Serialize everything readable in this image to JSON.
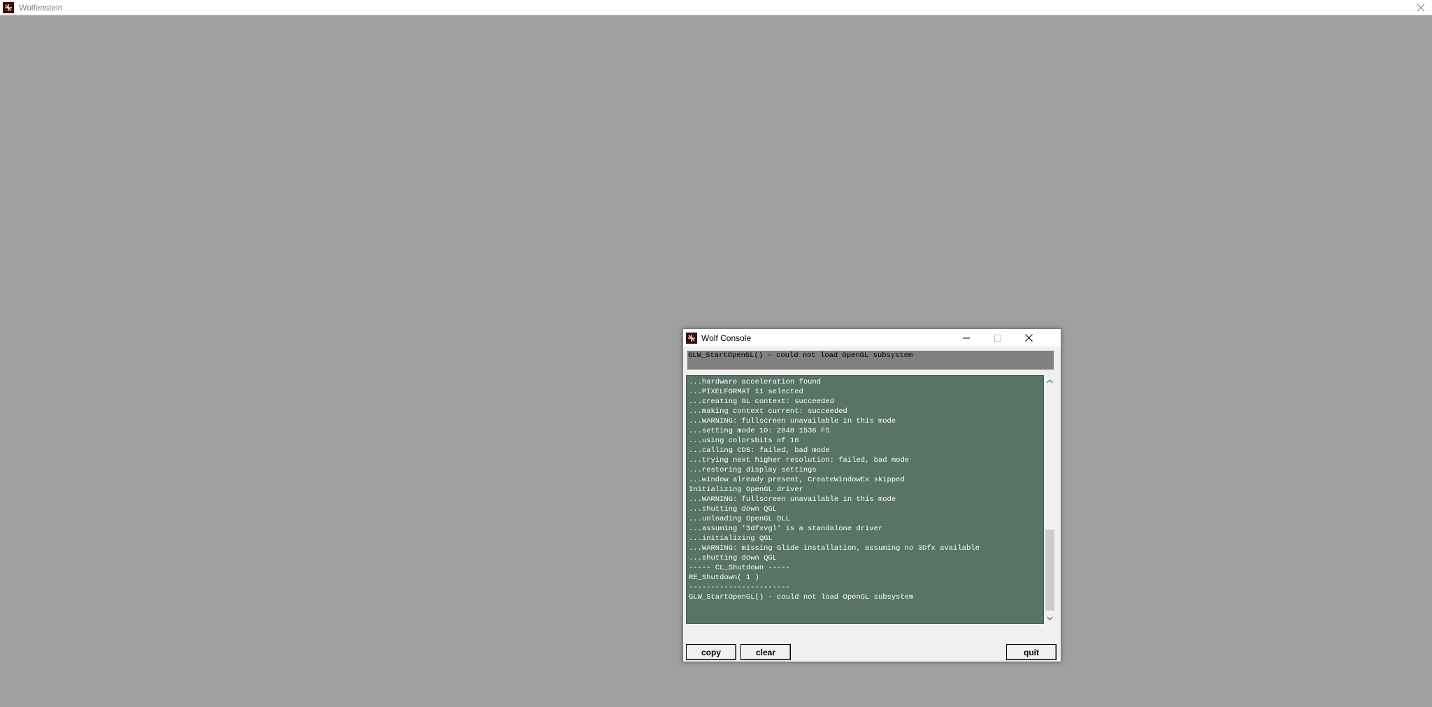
{
  "main_window": {
    "title": "Wolfenstein"
  },
  "console": {
    "title": "Wolf Console",
    "error_line": "GLW_StartOpenGL() - could not load OpenGL subsystem",
    "log_lines": [
      "...hardware acceleration found",
      "...PIXELFORMAT 11 selected",
      "...creating GL context: succeeded",
      "...making context current: succeeded",
      "...WARNING: fullscreen unavailable in this mode",
      "...setting mode 10: 2048 1536 FS",
      "...using colorsbits of 16",
      "...calling CDS: failed, bad mode",
      "...trying next higher resolution: failed, bad mode",
      "...restoring display settings",
      "...window already present, CreateWindowEx skipped",
      "Initializing OpenGL driver",
      "...WARNING: fullscreen unavailable in this mode",
      "...shutting down QGL",
      "...unloading OpenGL DLL",
      "...assuming '3dfxvgl' is a standalone driver",
      "...initializing QGL",
      "...WARNING: missing Glide installation, assuming no 3Dfx available",
      "...shutting down QGL",
      "----- CL_Shutdown -----",
      "RE_Shutdown( 1 )",
      "-----------------------",
      "GLW_StartOpenGL() - could not load OpenGL subsystem"
    ],
    "buttons": {
      "copy": "copy",
      "clear": "clear",
      "quit": "quit"
    },
    "scroll_position": 0.62
  },
  "colors": {
    "desktop_bg": "#a0a0a0",
    "log_bg": "#577465",
    "error_bg": "#808080"
  },
  "icons": {
    "app": "wolfenstein-app-icon",
    "minimize": "minimize-icon",
    "maximize": "maximize-icon",
    "close": "close-icon",
    "scroll_up": "chevron-up-icon",
    "scroll_down": "chevron-down-icon"
  }
}
